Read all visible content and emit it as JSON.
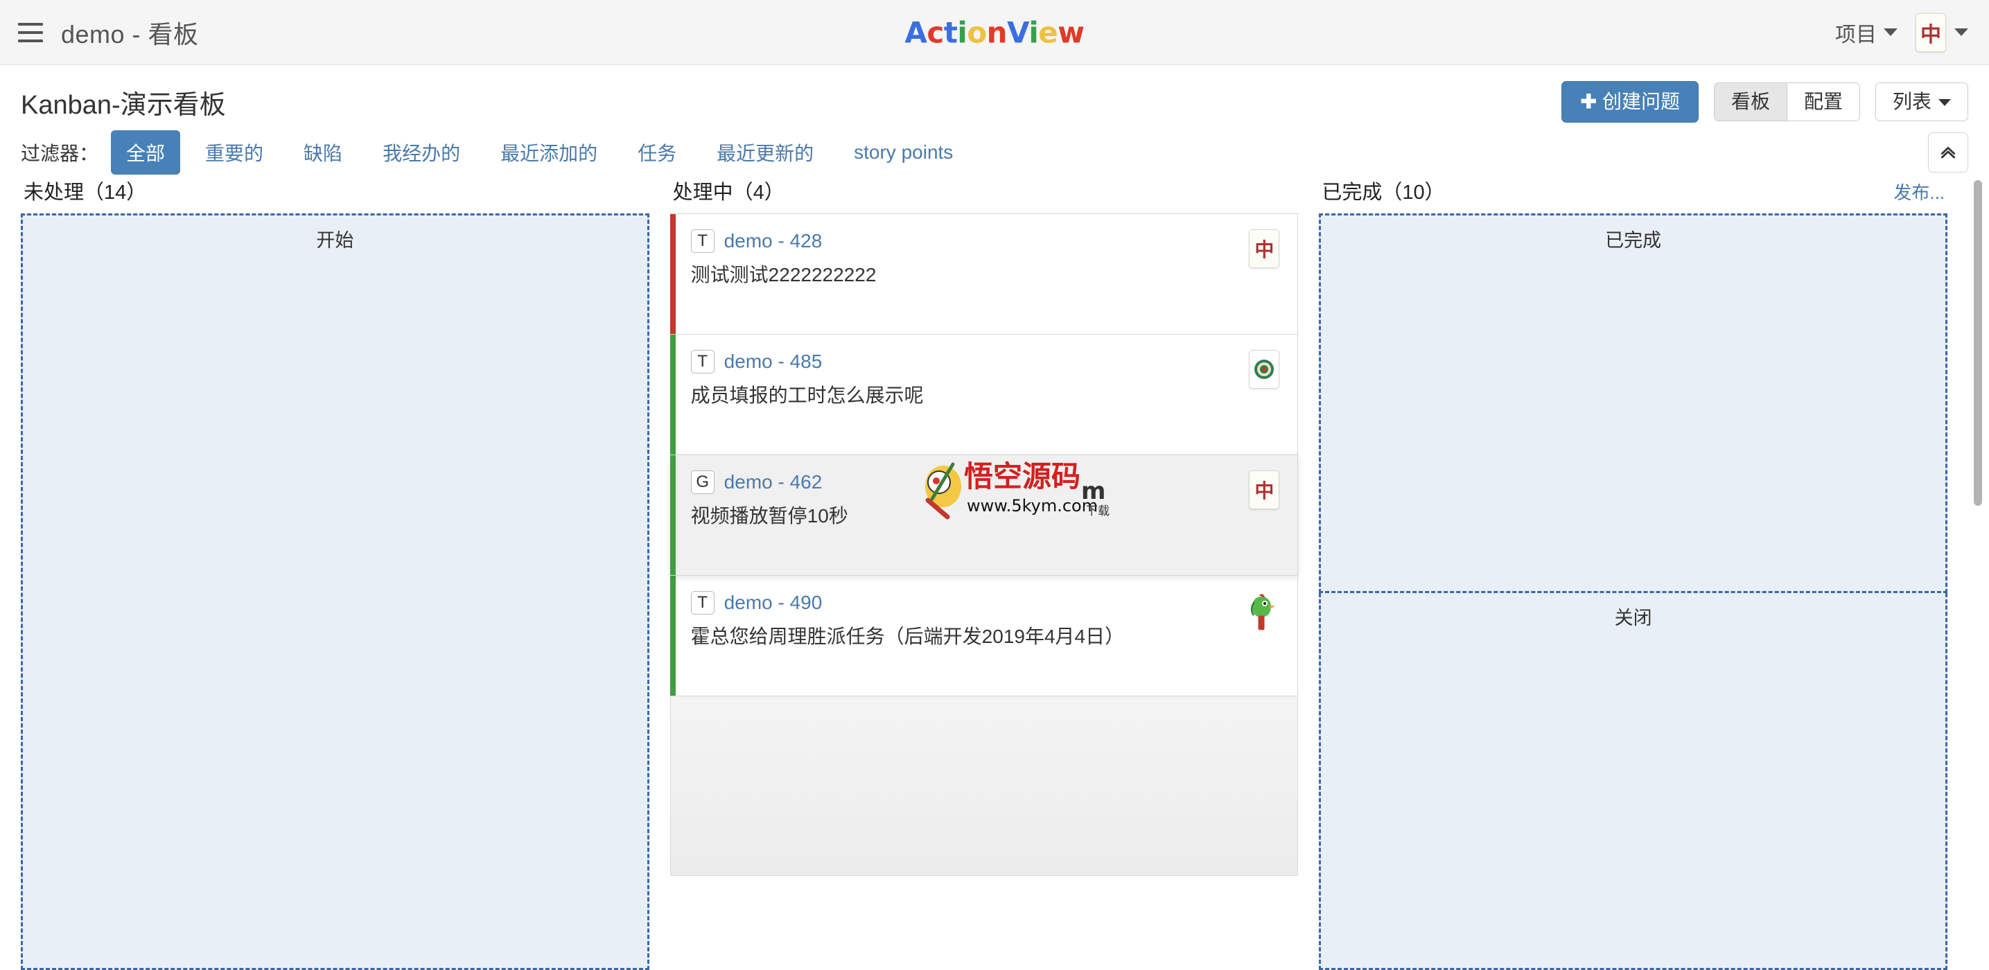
{
  "navbar": {
    "menu_icon": "hamburger-icon",
    "title": "demo - 看板",
    "logo_letters": [
      {
        "ch": "A",
        "color": "#3b6fe0"
      },
      {
        "ch": "c",
        "color": "#e03a28"
      },
      {
        "ch": "t",
        "color": "#3b6fe0"
      },
      {
        "ch": "i",
        "color": "#34a04a"
      },
      {
        "ch": "o",
        "color": "#f0c040"
      },
      {
        "ch": "n",
        "color": "#e03a28"
      },
      {
        "ch": "V",
        "color": "#3b6fe0"
      },
      {
        "ch": "i",
        "color": "#34a04a"
      },
      {
        "ch": "e",
        "color": "#f0c040"
      },
      {
        "ch": "w",
        "color": "#e03a28"
      }
    ],
    "logo_text": "ActionView",
    "project_menu": "项目",
    "user_avatar_text": "中"
  },
  "header": {
    "page_title": "Kanban-演示看板",
    "create_button": "创建问题",
    "create_button_plus": "✚",
    "view_buttons": [
      {
        "label": "看板",
        "active": true
      },
      {
        "label": "配置",
        "active": false
      }
    ],
    "list_button": "列表"
  },
  "filters": {
    "label": "过滤器：",
    "items": [
      {
        "label": "全部",
        "active": true
      },
      {
        "label": "重要的",
        "active": false
      },
      {
        "label": "缺陷",
        "active": false
      },
      {
        "label": "我经办的",
        "active": false
      },
      {
        "label": "最近添加的",
        "active": false
      },
      {
        "label": "任务",
        "active": false
      },
      {
        "label": "最近更新的",
        "active": false
      },
      {
        "label": "story points",
        "active": false
      }
    ],
    "collapse_icon": "chevron-double-up-icon"
  },
  "board": {
    "columns": [
      {
        "title": "未处理（14）",
        "name": "backlog",
        "release_link": "",
        "dropzones": [
          {
            "label": "开始"
          }
        ],
        "cards": []
      },
      {
        "title": "处理中（4）",
        "name": "in-progress",
        "release_link": "",
        "dropzones": [],
        "cards": [
          {
            "type": "T",
            "key": "demo - 428",
            "title": "测试测试2222222222",
            "stripe": "#c0392b",
            "avatar": "中",
            "avatar_kind": "tile",
            "hovered": false
          },
          {
            "type": "T",
            "key": "demo - 485",
            "title": "成员填报的工时怎么展示呢",
            "stripe": "#3f9f3f",
            "avatar": "",
            "avatar_kind": "circle",
            "hovered": false
          },
          {
            "type": "G",
            "key": "demo - 462",
            "title": "视频播放暂停10秒",
            "stripe": "#3f9f3f",
            "avatar": "中",
            "avatar_kind": "tile",
            "hovered": true
          },
          {
            "type": "T",
            "key": "demo - 490",
            "title": "霍总您给周理胜派任务（后端开发2019年4月4日）",
            "stripe": "#3f9f3f",
            "avatar": "",
            "avatar_kind": "parrot",
            "hovered": false
          }
        ]
      },
      {
        "title": "已完成（10）",
        "name": "done",
        "release_link": "发布...",
        "dropzones": [
          {
            "label": "已完成"
          },
          {
            "label": "关闭"
          }
        ],
        "cards": []
      }
    ]
  },
  "watermark": {
    "main_text": "悟空源码",
    "url_text": "www.5kym.com",
    "suffix": "下载"
  }
}
